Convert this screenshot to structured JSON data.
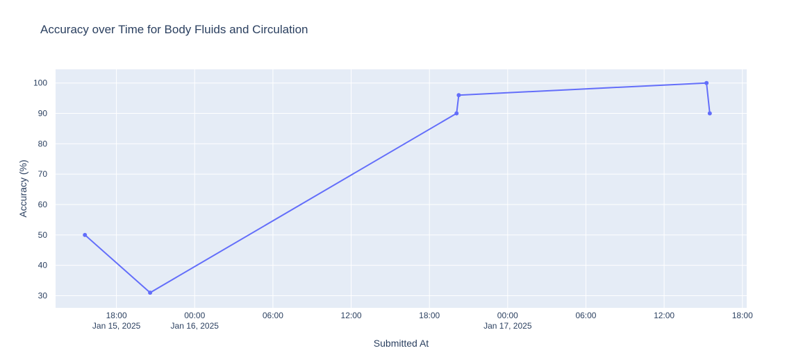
{
  "chart_data": {
    "type": "line",
    "title": "Accuracy over Time for Body Fluids and Circulation",
    "xlabel": "Submitted At",
    "ylabel": "Accuracy (%)",
    "x_type": "datetime",
    "xlim": [
      "2025-01-15 13:20",
      "2025-01-17 18:20"
    ],
    "ylim": [
      26,
      104.5
    ],
    "grid": true,
    "legend": "none",
    "colors": {
      "series": "#636efa",
      "plot_bg": "#e5ecf6",
      "grid": "#ffffff",
      "text": "#2a3f5f"
    },
    "x_ticks": [
      {
        "value": "2025-01-15 18:00",
        "label": "18:00",
        "sublabel": "Jan 15, 2025"
      },
      {
        "value": "2025-01-16 00:00",
        "label": "00:00",
        "sublabel": "Jan 16, 2025"
      },
      {
        "value": "2025-01-16 06:00",
        "label": "06:00",
        "sublabel": ""
      },
      {
        "value": "2025-01-16 12:00",
        "label": "12:00",
        "sublabel": ""
      },
      {
        "value": "2025-01-16 18:00",
        "label": "18:00",
        "sublabel": ""
      },
      {
        "value": "2025-01-17 00:00",
        "label": "00:00",
        "sublabel": "Jan 17, 2025"
      },
      {
        "value": "2025-01-17 06:00",
        "label": "06:00",
        "sublabel": ""
      },
      {
        "value": "2025-01-17 12:00",
        "label": "12:00",
        "sublabel": ""
      },
      {
        "value": "2025-01-17 18:00",
        "label": "18:00",
        "sublabel": ""
      }
    ],
    "y_ticks": [
      30,
      40,
      50,
      60,
      70,
      80,
      90,
      100
    ],
    "series": [
      {
        "x": [
          "2025-01-15 15:35",
          "2025-01-15 20:35",
          "2025-01-16 20:05",
          "2025-01-16 20:15",
          "2025-01-17 15:15",
          "2025-01-17 15:30"
        ],
        "y": [
          50,
          31,
          90,
          96,
          100,
          90
        ]
      }
    ]
  }
}
